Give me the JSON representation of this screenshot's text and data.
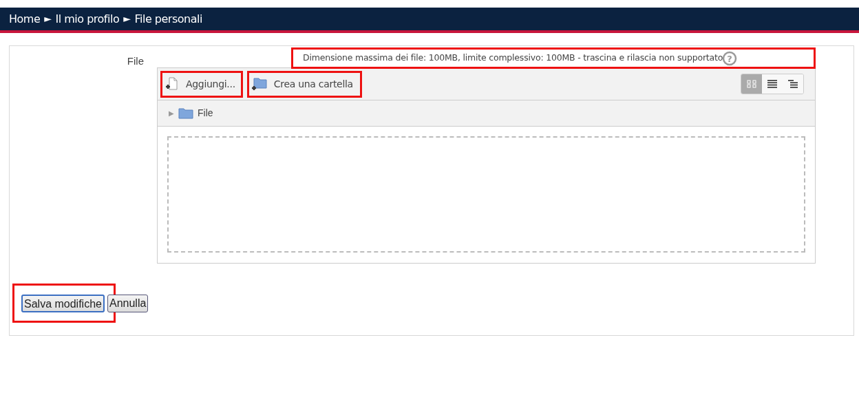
{
  "breadcrumb": [
    {
      "label": "Home"
    },
    {
      "label": "Il mio profilo"
    },
    {
      "label": "File personali"
    }
  ],
  "breadcrumb_separator": "►",
  "form": {
    "label": "File",
    "limits": "Dimensione massima dei file: 100MB, limite complessivo: 100MB - trascina e rilascia non supportato",
    "toolbar": [
      {
        "kind": "add-file",
        "label": "Aggiungi..."
      },
      {
        "kind": "new-folder",
        "label": "Crea una cartella"
      }
    ],
    "views": [
      {
        "kind": "icons",
        "selected": true
      },
      {
        "kind": "list",
        "selected": false
      },
      {
        "kind": "tree",
        "selected": false
      }
    ],
    "help_icon": "?",
    "path": {
      "expand_icon": "▶",
      "label": "File"
    }
  },
  "buttons": [
    {
      "label": "Salva modifiche",
      "primary": true
    },
    {
      "label": "Annulla",
      "primary": false
    }
  ]
}
